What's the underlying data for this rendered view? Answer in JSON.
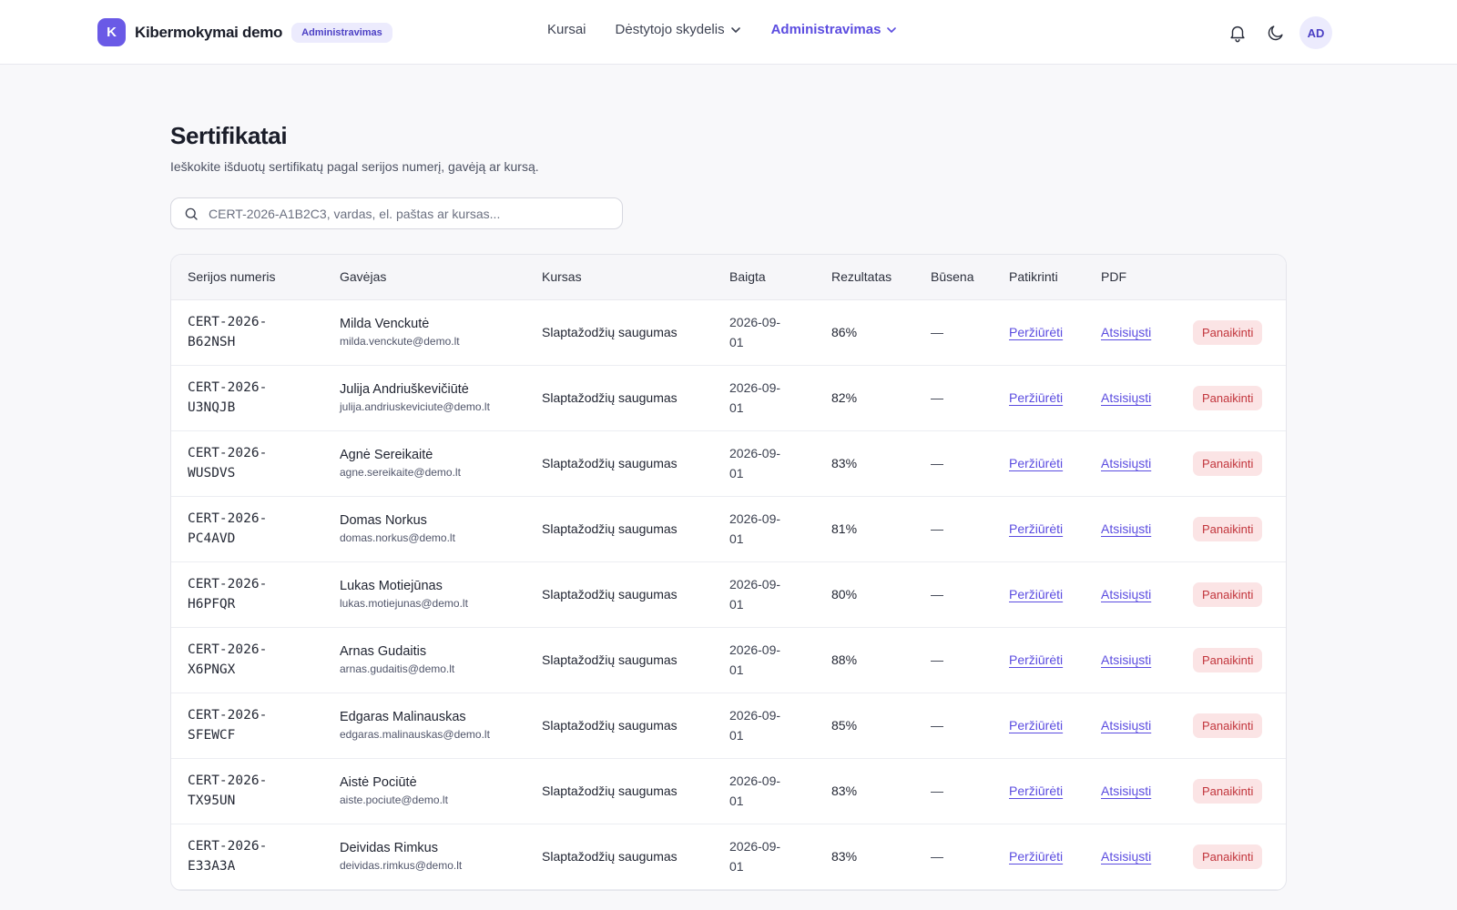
{
  "header": {
    "logo_letter": "K",
    "brand_name": "Kibermokymai demo",
    "badge": "Administravimas",
    "nav": [
      {
        "label": "Kursai"
      },
      {
        "label": "Dėstytojo skydelis"
      },
      {
        "label": "Administravimas"
      }
    ],
    "avatar_initials": "AD",
    "accent_color": "#5b4ce0"
  },
  "page": {
    "title": "Sertifikatai",
    "subtitle": "Ieškokite išduotų sertifikatų pagal serijos numerį, gavėją ar kursą.",
    "search_placeholder": "CERT-2026-A1B2C3, vardas, el. paštas ar kursas..."
  },
  "table": {
    "columns": [
      "Serijos numeris",
      "Gavėjas",
      "Kursas",
      "Baigta",
      "Rezultatas",
      "Būsena",
      "Patikrinti",
      "PDF",
      ""
    ],
    "rows": [
      {
        "serial_a": "CERT-2026-",
        "serial_b": "B62NSH",
        "name": "Milda Venckutė",
        "email": "milda.venckute@demo.lt",
        "course": "Slaptažodžių saugumas",
        "date_a": "2026-09-",
        "date_b": "01",
        "score": "86%",
        "status": "—",
        "verify": "Peržiūrėti",
        "pdf": "Atsisiųsti",
        "revoke": "Panaikinti"
      },
      {
        "serial_a": "CERT-2026-",
        "serial_b": "U3NQJB",
        "name": "Julija Andriuškevičiūtė",
        "email": "julija.andriuskeviciute@demo.lt",
        "course": "Slaptažodžių saugumas",
        "date_a": "2026-09-",
        "date_b": "01",
        "score": "82%",
        "status": "—",
        "verify": "Peržiūrėti",
        "pdf": "Atsisiųsti",
        "revoke": "Panaikinti"
      },
      {
        "serial_a": "CERT-2026-",
        "serial_b": "WUSDVS",
        "name": "Agnė Sereikaitė",
        "email": "agne.sereikaite@demo.lt",
        "course": "Slaptažodžių saugumas",
        "date_a": "2026-09-",
        "date_b": "01",
        "score": "83%",
        "status": "—",
        "verify": "Peržiūrėti",
        "pdf": "Atsisiųsti",
        "revoke": "Panaikinti"
      },
      {
        "serial_a": "CERT-2026-",
        "serial_b": "PC4AVD",
        "name": "Domas Norkus",
        "email": "domas.norkus@demo.lt",
        "course": "Slaptažodžių saugumas",
        "date_a": "2026-09-",
        "date_b": "01",
        "score": "81%",
        "status": "—",
        "verify": "Peržiūrėti",
        "pdf": "Atsisiųsti",
        "revoke": "Panaikinti"
      },
      {
        "serial_a": "CERT-2026-",
        "serial_b": "H6PFQR",
        "name": "Lukas Motiejūnas",
        "email": "lukas.motiejunas@demo.lt",
        "course": "Slaptažodžių saugumas",
        "date_a": "2026-09-",
        "date_b": "01",
        "score": "80%",
        "status": "—",
        "verify": "Peržiūrėti",
        "pdf": "Atsisiųsti",
        "revoke": "Panaikinti"
      },
      {
        "serial_a": "CERT-2026-",
        "serial_b": "X6PNGX",
        "name": "Arnas Gudaitis",
        "email": "arnas.gudaitis@demo.lt",
        "course": "Slaptažodžių saugumas",
        "date_a": "2026-09-",
        "date_b": "01",
        "score": "88%",
        "status": "—",
        "verify": "Peržiūrėti",
        "pdf": "Atsisiųsti",
        "revoke": "Panaikinti"
      },
      {
        "serial_a": "CERT-2026-",
        "serial_b": "SFEWCF",
        "name": "Edgaras Malinauskas",
        "email": "edgaras.malinauskas@demo.lt",
        "course": "Slaptažodžių saugumas",
        "date_a": "2026-09-",
        "date_b": "01",
        "score": "85%",
        "status": "—",
        "verify": "Peržiūrėti",
        "pdf": "Atsisiųsti",
        "revoke": "Panaikinti"
      },
      {
        "serial_a": "CERT-2026-",
        "serial_b": "TX95UN",
        "name": "Aistė Pociūtė",
        "email": "aiste.pociute@demo.lt",
        "course": "Slaptažodžių saugumas",
        "date_a": "2026-09-",
        "date_b": "01",
        "score": "83%",
        "status": "—",
        "verify": "Peržiūrėti",
        "pdf": "Atsisiųsti",
        "revoke": "Panaikinti"
      },
      {
        "serial_a": "CERT-2026-",
        "serial_b": "E33A3A",
        "name": "Deividas Rimkus",
        "email": "deividas.rimkus@demo.lt",
        "course": "Slaptažodžių saugumas",
        "date_a": "2026-09-",
        "date_b": "01",
        "score": "83%",
        "status": "—",
        "verify": "Peržiūrėti",
        "pdf": "Atsisiųsti",
        "revoke": "Panaikinti"
      }
    ]
  },
  "icons": {
    "search": "search-icon",
    "notifications": "bell-icon",
    "theme": "moon-icon",
    "dropdown": "chevron-down-icon"
  }
}
